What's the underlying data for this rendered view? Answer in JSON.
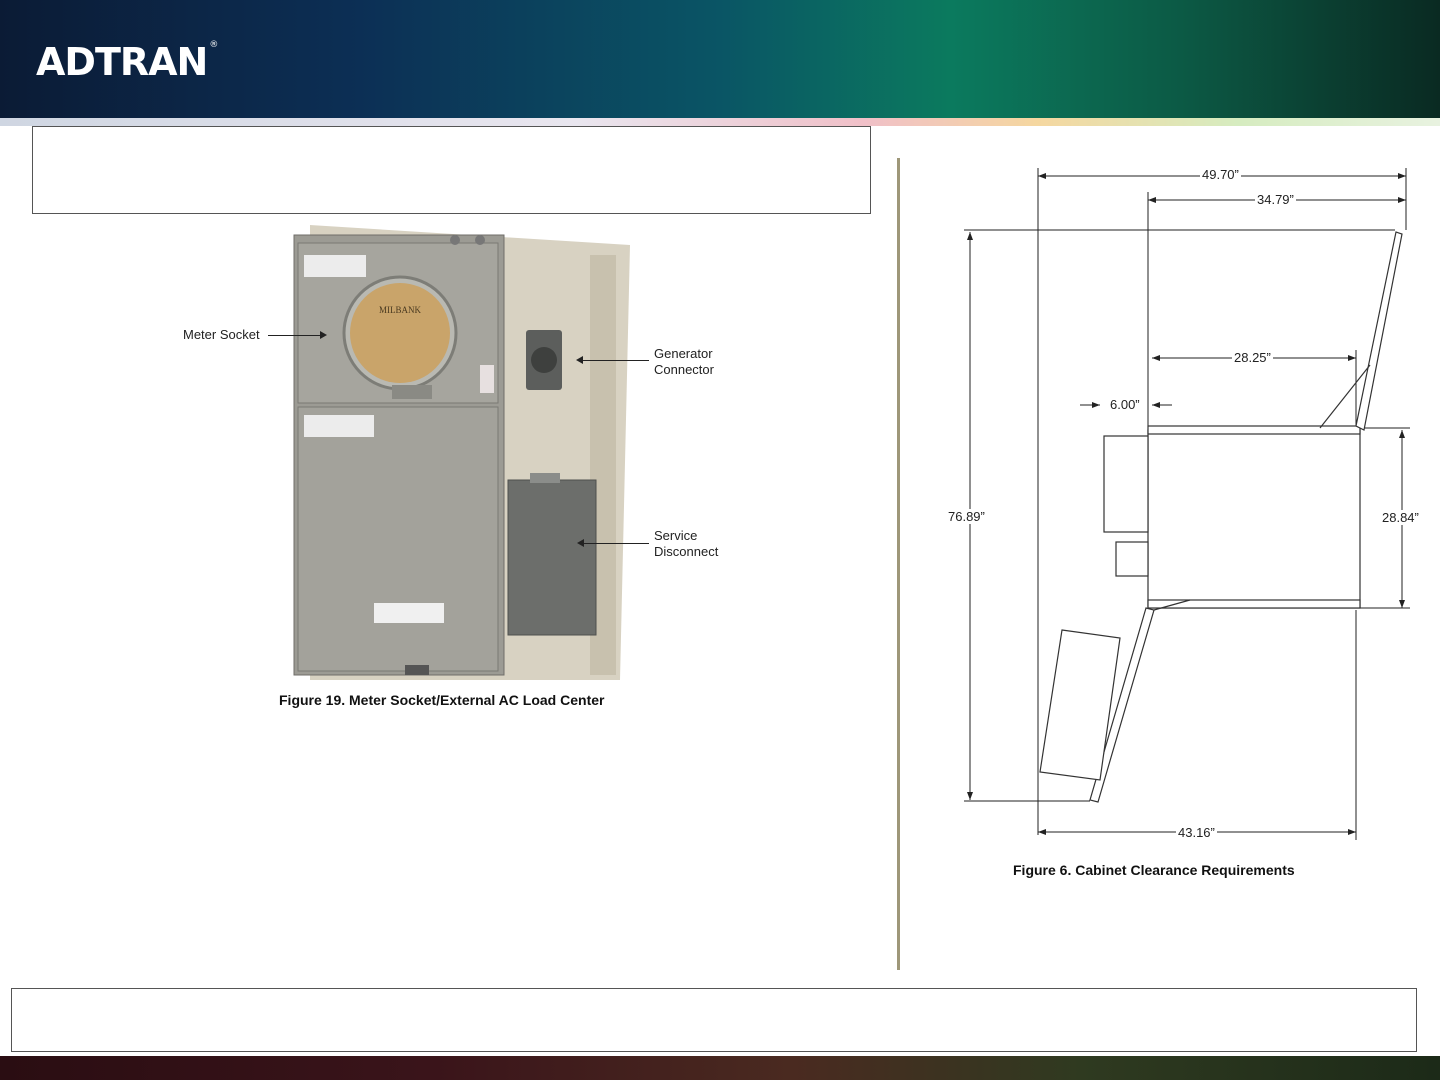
{
  "header": {
    "logo_text": "ADTRAN",
    "registered_mark": "®"
  },
  "left_figure": {
    "callouts": {
      "meter_socket": "Meter Socket",
      "generator_connector": "Generator\nConnector",
      "service_disconnect": "Service\nDisconnect"
    },
    "caption": "Figure 19.  Meter Socket/External AC Load Center"
  },
  "right_figure": {
    "dimensions": {
      "d1": "49.70”",
      "d2": "34.79”",
      "d3": "28.25”",
      "d4": "6.00”",
      "d5": "76.89”",
      "d6": "28.84”",
      "d7": "43.16”"
    },
    "caption": "Figure 6.  Cabinet Clearance Requirements"
  },
  "colors": {
    "divider": "#9e9779",
    "cabinet_fill": "#d9d6cb",
    "meter_face": "#c9a46a"
  }
}
